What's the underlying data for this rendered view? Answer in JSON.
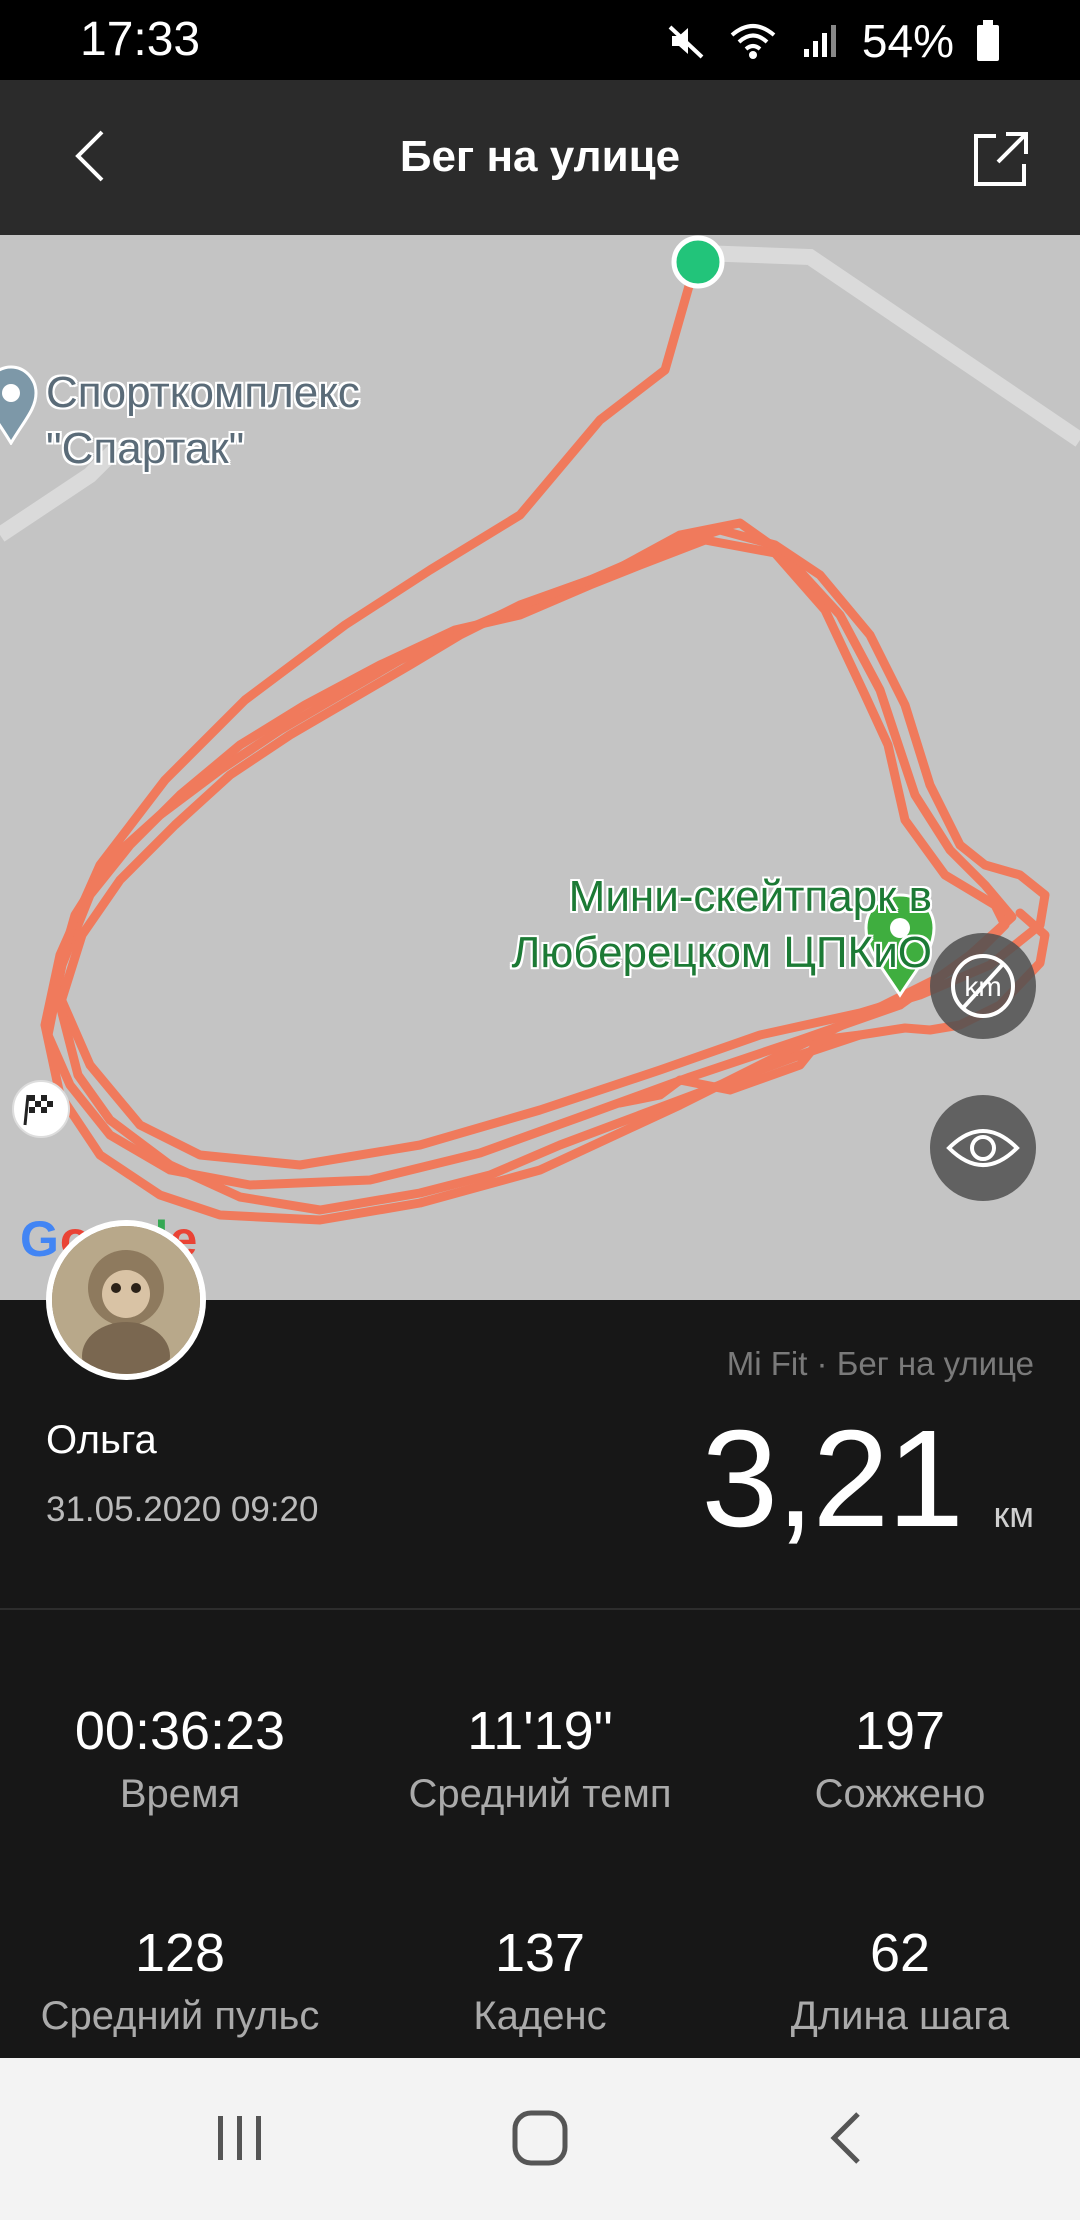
{
  "status_bar": {
    "time": "17:33",
    "battery": "54%"
  },
  "app_bar": {
    "title": "Бег на улице"
  },
  "map": {
    "poi_sport": [
      "Спорткомплекс",
      "\"Спартак\""
    ],
    "poi_skate": [
      "Мини-скейтпарк в",
      "Люберецком ЦПКиО"
    ],
    "google_logo": "Google",
    "route_color": "#f07a5c",
    "start_color": "#22c47a",
    "pin_color": "#3fae3f"
  },
  "summary": {
    "source": "Mi Fit · Бег на улице",
    "user": "Ольга",
    "date": "31.05.2020 09:20",
    "distance": "3,21",
    "unit": "км"
  },
  "stats": [
    {
      "value": "00:36:23",
      "label": "Время"
    },
    {
      "value": "11'19\"",
      "label": "Средний темп"
    },
    {
      "value": "197",
      "label": "Сожжено"
    },
    {
      "value": "128",
      "label": "Средний пульс"
    },
    {
      "value": "137",
      "label": "Каденс"
    },
    {
      "value": "62",
      "label": "Длина шага"
    }
  ]
}
